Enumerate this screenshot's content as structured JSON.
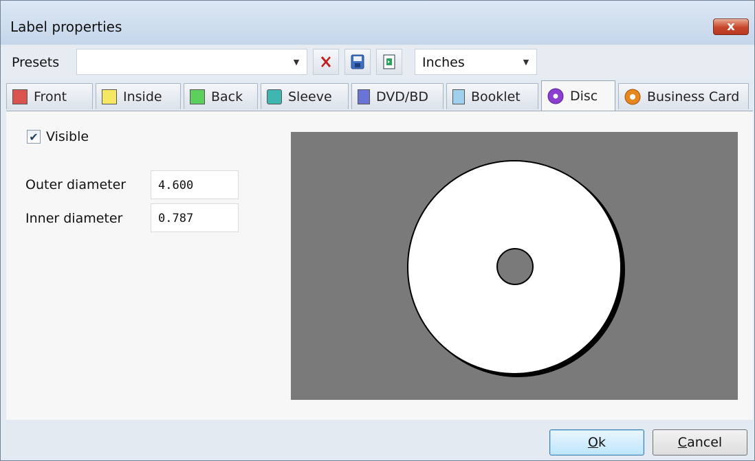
{
  "window": {
    "title": "Label properties",
    "close_symbol": "x"
  },
  "presets": {
    "label": "Presets",
    "combo_value": "",
    "units_value": "Inches"
  },
  "tabs": [
    {
      "label": "Front",
      "icon": "front-icon",
      "color": "#d9534f"
    },
    {
      "label": "Inside",
      "icon": "inside-icon",
      "color": "#f5e663"
    },
    {
      "label": "Back",
      "icon": "back-icon",
      "color": "#5ccf5c"
    },
    {
      "label": "Sleeve",
      "icon": "sleeve-icon",
      "color": "#3fb6b0"
    },
    {
      "label": "DVD/BD",
      "icon": "dvd-icon",
      "color": "#6a73d6"
    },
    {
      "label": "Booklet",
      "icon": "booklet-icon",
      "color": "#9fd0ee"
    },
    {
      "label": "Disc",
      "icon": "disc-icon",
      "color": "#8a3fd1",
      "active": true
    },
    {
      "label": "Business Card",
      "icon": "business-card-icon",
      "color": "#e8861f"
    }
  ],
  "disc": {
    "visible_label": "Visible",
    "visible_checked": true,
    "outer_label": "Outer diameter",
    "outer_value": "4.600",
    "inner_label": "Inner diameter",
    "inner_value": "0.787"
  },
  "buttons": {
    "ok_first": "O",
    "ok_rest": "k",
    "cancel_first": "C",
    "cancel_rest": "ancel"
  }
}
